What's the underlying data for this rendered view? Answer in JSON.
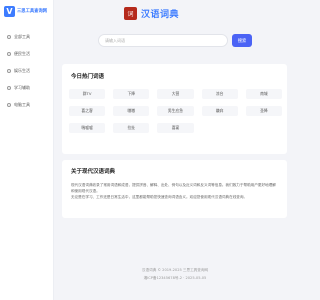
{
  "app": {
    "logo_mark": "V",
    "logo_text": "三思工具查询网"
  },
  "sidebar": {
    "items": [
      {
        "label": "全部工具",
        "icon": "grid-icon"
      },
      {
        "label": "便民生活",
        "icon": "home-icon"
      },
      {
        "label": "娱乐生活",
        "icon": "smile-icon"
      },
      {
        "label": "学习辅助",
        "icon": "book-icon"
      },
      {
        "label": "电脑工具",
        "icon": "monitor-icon"
      }
    ]
  },
  "hero": {
    "seal_text": "词",
    "title": "汉语词典"
  },
  "search": {
    "placeholder": "请输入词语",
    "button_label": "搜索"
  },
  "hot_words": {
    "title": "今日热门词语",
    "items": [
      "群TV",
      "下降",
      "大营",
      "凉台",
      "南城",
      "喜之客",
      "嗷嗷",
      "男生应急",
      "嫌弃",
      "圣降",
      "喘嘘嘘",
      "拉扯",
      "喜宴"
    ]
  },
  "about": {
    "title": "关于现代汉语词典",
    "paragraph_1": "现代汉语词典收录了常用词语和成语，提供拼音、解释、出处、例句以及近义词和反义词等信息。我们致力于帮助用户更好地理解和使用现代汉语。",
    "paragraph_2": "无论是在学习、工作还是日常生活中，这里都能帮助您快速查询词语含义。欢迎您使用现代汉语词典在线查询。"
  },
  "footer": {
    "copyright": "汉语词典 © 2019-2025 三思工具查询网",
    "record": "湘ICP备12345678号-2 · 2025-05-05"
  }
}
